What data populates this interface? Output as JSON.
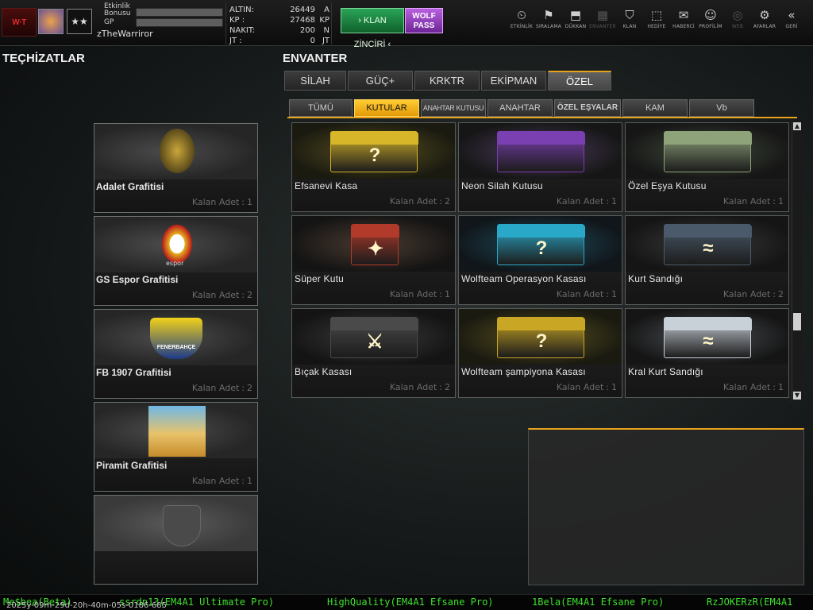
{
  "header": {
    "logo_text": "W·T",
    "bonus_label": "Etkinlik Bonusu",
    "gp_label": "GP",
    "nickname": "zTheWarriror",
    "stars": "★★"
  },
  "currency": [
    {
      "label": "ALTIN:",
      "value": "26449",
      "unit": "A"
    },
    {
      "label": "KP :",
      "value": "27468",
      "unit": "KP"
    },
    {
      "label": "NAKIT:",
      "value": "200",
      "unit": "N"
    },
    {
      "label": "JT :",
      "value": "0",
      "unit": "JT"
    }
  ],
  "buttons": {
    "klan": "› KLAN ZİNCİRİ ‹",
    "wolf_line1": "WOLF",
    "wolf_line2": "PASS"
  },
  "nav": [
    {
      "label": "ETKİNLİK",
      "icon": "⏲",
      "enabled": true
    },
    {
      "label": "SIRALAMA",
      "icon": "⚑",
      "enabled": true
    },
    {
      "label": "DÜKKAN",
      "icon": "⬒",
      "enabled": true
    },
    {
      "label": "ENVANTER",
      "icon": "▦",
      "enabled": false
    },
    {
      "label": "KLAN",
      "icon": "⛉",
      "enabled": true
    },
    {
      "label": "HEDİYE",
      "icon": "⬚",
      "enabled": true
    },
    {
      "label": "HABERCİ",
      "icon": "✉",
      "enabled": true
    },
    {
      "label": "PROFİLİM",
      "icon": "☺",
      "enabled": true
    },
    {
      "label": "WEB",
      "icon": "◎",
      "enabled": false
    },
    {
      "label": "AYARLAR",
      "icon": "⚙",
      "enabled": true
    },
    {
      "label": "GERİ",
      "icon": "«",
      "enabled": true
    }
  ],
  "left_panel": {
    "title": "TEÇHİZATLAR",
    "items": [
      {
        "name": "Adalet Grafitisi",
        "qty_label": "Kalan Adet",
        "qty": "1"
      },
      {
        "name": "GS Espor Grafitisi",
        "qty_label": "Kalan Adet",
        "qty": "2"
      },
      {
        "name": "FB 1907 Grafitisi",
        "qty_label": "Kalan Adet",
        "qty": "2"
      },
      {
        "name": "Piramit Grafitisi",
        "qty_label": "Kalan Adet",
        "qty": "1"
      }
    ],
    "gs_sub": "espor",
    "fb_text": "FENERBAHÇE"
  },
  "right_panel": {
    "title": "ENVANTER",
    "main_tabs": [
      "SİLAH",
      "GÜÇ+",
      "KRKTR",
      "EKİPMAN",
      "ÖZEL"
    ],
    "active_main_tab": 4,
    "sub_tabs": [
      "TÜMÜ",
      "KUTULAR",
      "ANAHTAR KUTUSU",
      "ANAHTAR",
      "ÖZEL EŞYALAR",
      "KAM",
      "Vb"
    ],
    "active_sub_tab": 1,
    "items": [
      {
        "name": "Efsanevi Kasa",
        "qty_label": "Kalan Adet",
        "qty": "2",
        "color": "#d8b62a",
        "mark": "?"
      },
      {
        "name": "Neon Silah Kutusu",
        "qty_label": "Kalan Adet",
        "qty": "1",
        "color": "#7a3fb0",
        "mark": ""
      },
      {
        "name": "Özel Eşya Kutusu",
        "qty_label": "Kalan Adet",
        "qty": "1",
        "color": "#8fa37a",
        "mark": ""
      },
      {
        "name": "Süper Kutu",
        "qty_label": "Kalan Adet",
        "qty": "1",
        "color": "#b23a2a",
        "mark": "✦"
      },
      {
        "name": "Wolfteam Operasyon Kasası",
        "qty_label": "Kalan Adet",
        "qty": "1",
        "color": "#2aa8c8",
        "mark": "?"
      },
      {
        "name": "Kurt Sandığı",
        "qty_label": "Kalan Adet",
        "qty": "2",
        "color": "#4a5a6a",
        "mark": "≈"
      },
      {
        "name": "Bıçak Kasası",
        "qty_label": "Kalan Adet",
        "qty": "2",
        "color": "#4a4a4a",
        "mark": "⚔"
      },
      {
        "name": "Wolfteam şampiyona Kasası",
        "qty_label": "Kalan Adet",
        "qty": "1",
        "color": "#c9a623",
        "mark": "?"
      },
      {
        "name": "Kral Kurt Sandığı",
        "qty_label": "Kalan Adet",
        "qty": "1",
        "color": "#c8d0d8",
        "mark": "≈"
      }
    ]
  },
  "footer": {
    "timestamp": "2025y-09m-29d-20h-40m-05s-0186-685",
    "players": [
      "Me$bea(Beta)",
      "ssrdn13(EM4A1 Ultimate Pro)",
      "HighQuality(EM4A1 Efsane Pro)",
      "1Bela(EM4A1 Efsane Pro)",
      "RzJOKERzR(EM4A1"
    ]
  },
  "colors": {
    "accent": "#e8a21c",
    "player_text": "#3fe02f"
  }
}
